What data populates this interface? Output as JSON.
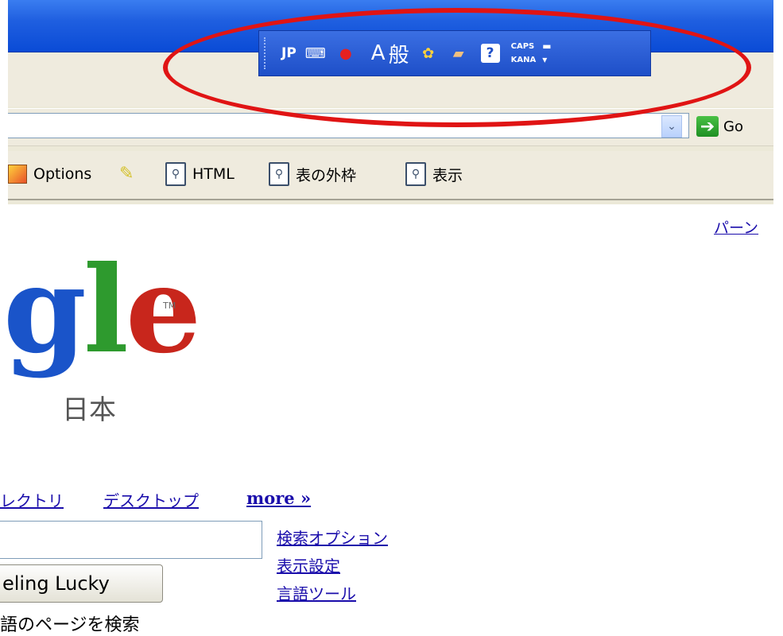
{
  "browser": {
    "address_bar": {
      "value": "",
      "dropdown_icon": "chevron-down",
      "go_label": "Go"
    },
    "links_toolbar": [
      {
        "label": "Options",
        "icon": "options-icon"
      },
      {
        "label": "",
        "icon": "highlighter-icon"
      },
      {
        "label": "HTML",
        "icon": "magnifier-page-icon"
      },
      {
        "label": "表の外枠",
        "icon": "magnifier-page-icon"
      },
      {
        "label": "表示",
        "icon": "magnifier-page-icon"
      }
    ]
  },
  "ime_bar": {
    "language": "JP",
    "input_mode": "A",
    "conversion_mode": "般",
    "caps": "CAPS",
    "kana": "KANA",
    "help": "?",
    "highlight_color": "#e01414"
  },
  "page": {
    "top_right_link": "パーン",
    "logo": {
      "letters_g": "g",
      "letters_l": "l",
      "letters_e": "e",
      "tm": "TM",
      "subtitle": "日本"
    },
    "tabs": {
      "directory": "レクトリ",
      "desktop": "デスクトップ",
      "more": "more »"
    },
    "search": {
      "query": "",
      "lucky_button": "eling Lucky"
    },
    "side_links": [
      "検索オプション",
      "表示設定",
      "言語ツール"
    ],
    "radio_label": "語のページを検索"
  }
}
